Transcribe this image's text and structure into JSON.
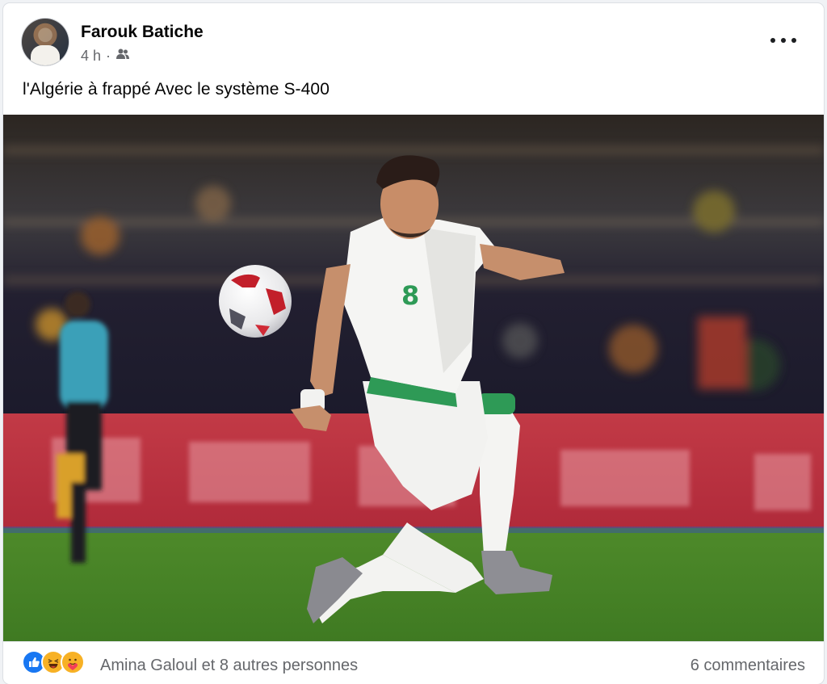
{
  "post": {
    "author": "Farouk Batiche",
    "time": "4 h",
    "audience_icon": "friends-icon",
    "caption": "l'Algérie à frappé Avec le  système S-400",
    "photo_icon": "photo",
    "reactions": [
      "like-icon",
      "haha-icon",
      "care-icon"
    ],
    "likers_text": "Amina Galoul et 8 autres personnes",
    "comments_text": "6 commentaires"
  },
  "colors": {
    "accent": "#1877f2",
    "text_secondary": "#65676b",
    "text_primary": "#050505"
  }
}
